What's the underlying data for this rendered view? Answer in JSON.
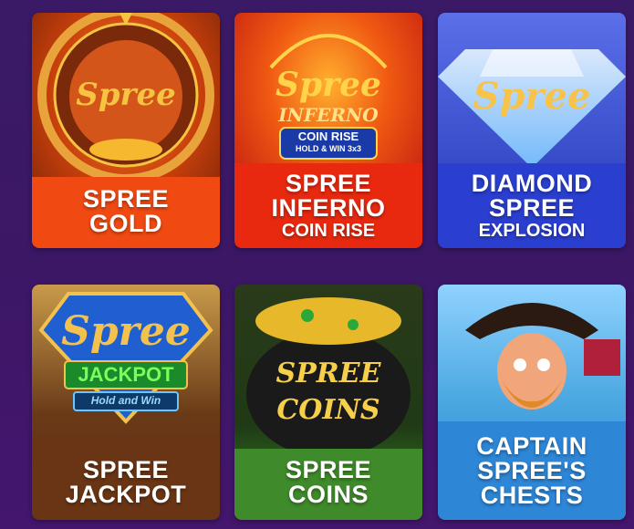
{
  "games": [
    {
      "title_lines": [
        "SPREE",
        "GOLD"
      ],
      "sub_line": "",
      "logo_word": "Spree",
      "colors": {
        "top": "#c2410c",
        "bottom": "#f04a12",
        "logo": "#f5c542"
      }
    },
    {
      "title_lines": [
        "SPREE",
        "INFERNO"
      ],
      "sub_line": "COIN RISE",
      "logo_word": "Spree",
      "logo_sub": "INFERNO",
      "badge": "COIN RISE",
      "badge_sub": "HOLD & WIN 3x3",
      "colors": {
        "top": "#d62b13",
        "bottom": "#e8290f",
        "logo": "#ffd34a"
      }
    },
    {
      "title_lines": [
        "DIAMOND",
        "SPREE"
      ],
      "sub_line": "EXPLOSION",
      "logo_word": "Spree",
      "colors": {
        "top": "#3b4fd6",
        "bottom": "#2a3fcf",
        "logo": "#f7c34a"
      }
    },
    {
      "title_lines": [
        "SPREE",
        "JACKPOT"
      ],
      "sub_line": "",
      "logo_word": "Spree",
      "logo_sub": "JACKPOT",
      "badge": "Hold and Win",
      "colors": {
        "top": "#5a3a1a",
        "bottom": "#6a3515",
        "logo": "#f2c14e"
      }
    },
    {
      "title_lines": [
        "SPREE",
        "COINS"
      ],
      "sub_line": "",
      "logo_word": "SPREE COINS",
      "colors": {
        "top": "#1f4a15",
        "bottom": "#3f8a2a",
        "logo": "#f6d04a"
      }
    },
    {
      "title_lines": [
        "CAPTAIN",
        "SPREE'S",
        "CHESTS"
      ],
      "sub_line": "",
      "colors": {
        "top": "#4aa7e0",
        "bottom": "#2e86d6",
        "logo": "#ffffff"
      }
    }
  ]
}
